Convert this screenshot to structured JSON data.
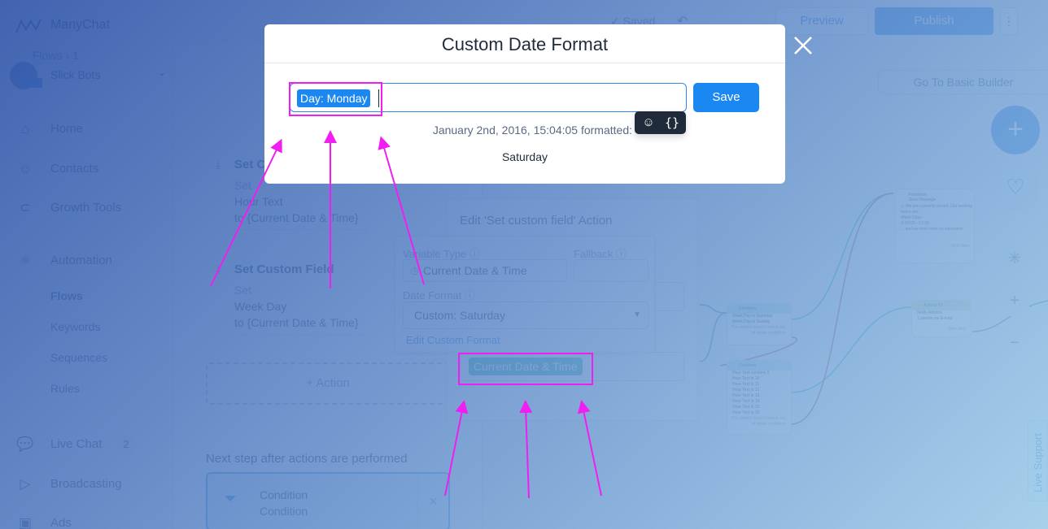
{
  "app": {
    "brand": "ManyChat",
    "account_name": "Slick Bots"
  },
  "sidebar": {
    "items": [
      {
        "label": "Home",
        "icon": "home-icon"
      },
      {
        "label": "Contacts",
        "icon": "user-icon"
      },
      {
        "label": "Growth Tools",
        "icon": "magnet-icon"
      },
      {
        "label": "Automation",
        "icon": "atom-icon"
      },
      {
        "label": "Live Chat",
        "icon": "chat-bubble-icon",
        "badge": "2"
      },
      {
        "label": "Broadcasting",
        "icon": "send-icon"
      },
      {
        "label": "Ads",
        "icon": "facebook-ad-icon"
      }
    ],
    "automation_sub": [
      "Flows",
      "Keywords",
      "Sequences",
      "Rules"
    ],
    "active_sub": "Flows"
  },
  "topbar": {
    "breadcrumb_root": "Flows",
    "breadcrumb_sep": "›",
    "breadcrumb_next": "1",
    "saved_status": "✓ Saved",
    "undo_icon": "↶",
    "preview_label": "Preview",
    "publish_label": "Publish",
    "more_icon": "⋮",
    "basic_builder_label": "Go To Basic Builder"
  },
  "actions": [
    {
      "title": "Set Custom Field",
      "line1": "Set",
      "field": "Hour Text",
      "value": "to {Current Date & Time}"
    },
    {
      "title": "Set Custom Field",
      "line1": "Set",
      "field": "Week Day",
      "value": "to {Current Date & Time}"
    }
  ],
  "add_action_label": "+ Action",
  "next_step": {
    "label": "Next step after actions are performed",
    "card_title": "Condition",
    "card_subtitle": "Condition"
  },
  "edit_panel": {
    "title": "Edit 'Set custom field' Action",
    "chip": "Current Date & Time"
  },
  "var_popup": {
    "variable_type_label": "Variable Type",
    "variable_type_value": "Current Date & Time",
    "fallback_label": "Fallback",
    "fallback_value": "",
    "date_format_label": "Date Format",
    "date_format_value": "Custom: Saturday",
    "edit_link": "Edit Custom Format"
  },
  "canvas": {
    "send_message": {
      "source": "Facebook",
      "title": "Send Message",
      "lines": [
        "⚠ We are currently closed. Our working",
        "hours are:",
        "",
        "Week Days",
        "⏱ 09:00 - 17:00",
        "",
        "... and we don't work on weekends."
      ],
      "footer": "Next Step"
    },
    "condition1": {
      "title": "Condition",
      "lines": [
        "Week Day is Saturday",
        "Week Day is Sunday"
      ],
      "footer": "The contact doesn't match any of these conditions"
    },
    "condition2": {
      "title": "Condition",
      "lines": [
        "Hour Text contains 9",
        "Hour Text is 10",
        "Hour Text is 11",
        "Hour Text is 12",
        "Hour Text is 13",
        "Hour Text is 14",
        "Hour Text is 15",
        "Hour Text is 16"
      ],
      "footer": "The contact doesn't match any of these conditions"
    },
    "action3": {
      "title": "Actions #3",
      "lines": [
        "Notify Admins",
        "1 person via E-mail"
      ],
      "footer": "Next Step"
    }
  },
  "rail": {
    "add_icon": "+",
    "heart_icon": "♡",
    "magic_icon": "✳",
    "zoom_in_icon": "+",
    "zoom_out_icon": "−",
    "live_support": "Live Support"
  },
  "modal": {
    "title": "Custom Date Format",
    "input_value": "Day: Monday",
    "save_label": "Save",
    "emoji_icon": "☺",
    "variable_icon": "{}",
    "formatted_label": "January 2nd, 2016, 15:04:05 formatted:",
    "formatted_value": "Saturday"
  },
  "colors": {
    "accent": "#1a88f0",
    "annotation": "#f01ef0",
    "chip": "#35b0a6"
  }
}
